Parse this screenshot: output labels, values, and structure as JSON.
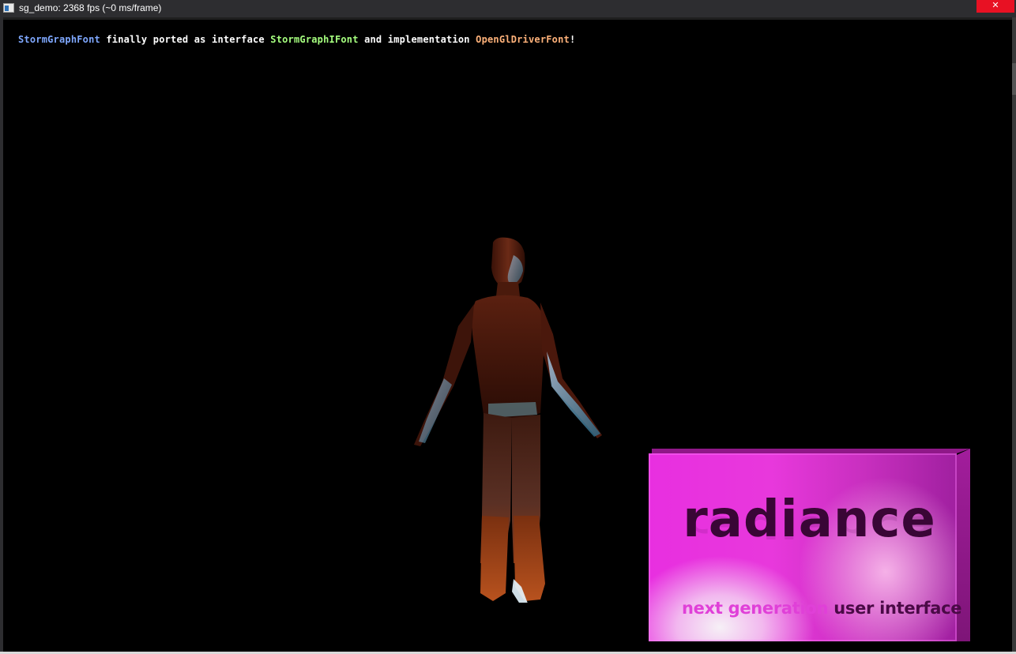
{
  "window": {
    "title": "sg_demo: 2368 fps (~0 ms/frame)",
    "close_label": "✕"
  },
  "message": {
    "segments": [
      "StormGraphFont",
      " finally ported as interface ",
      "StormGraphIFont",
      " and implementation ",
      "OpenGlDriverFont",
      "!"
    ]
  },
  "badge": {
    "title": "radiance",
    "subtitle_part1": "next generation",
    "subtitle_part2": " user interface"
  },
  "colors": {
    "viewport_background": "#000000",
    "font_class_blue": "#7fa8ff",
    "font_class_green": "#a6ff7f",
    "font_class_orange": "#ffb27a",
    "badge_magenta": "#e82fe0"
  }
}
